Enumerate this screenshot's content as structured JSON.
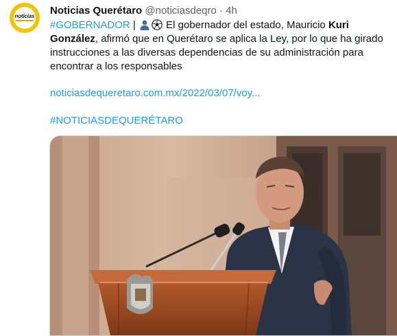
{
  "tweet": {
    "author_name": "Noticias Querétaro",
    "author_handle": "@noticiasdeqro",
    "separator": "·",
    "time": "4h",
    "avatar_text": "noticias",
    "hashtag_top": "#GOBERNADOR",
    "pipe": "|",
    "text_part1": "El gobernador del estado, Mauricio",
    "text_bold": "Kuri González",
    "text_part2": ", afirmó que en Querétaro se aplica la Ley, por lo que ha girado instrucciones a las diversas dependencias de su administración para encontrar a los responsables",
    "link": "noticiasdequeretaro.com.mx/2022/03/07/voy...",
    "hashtag_bottom": "#NOTICIASDEQUERÉTARO"
  },
  "icons": {
    "bust": "bust-in-silhouette-icon",
    "ball": "soccer-ball-icon"
  },
  "colors": {
    "link": "#1d9bf0",
    "text": "#0f1419",
    "muted": "#536471",
    "avatar_bg": "#f5c400"
  }
}
